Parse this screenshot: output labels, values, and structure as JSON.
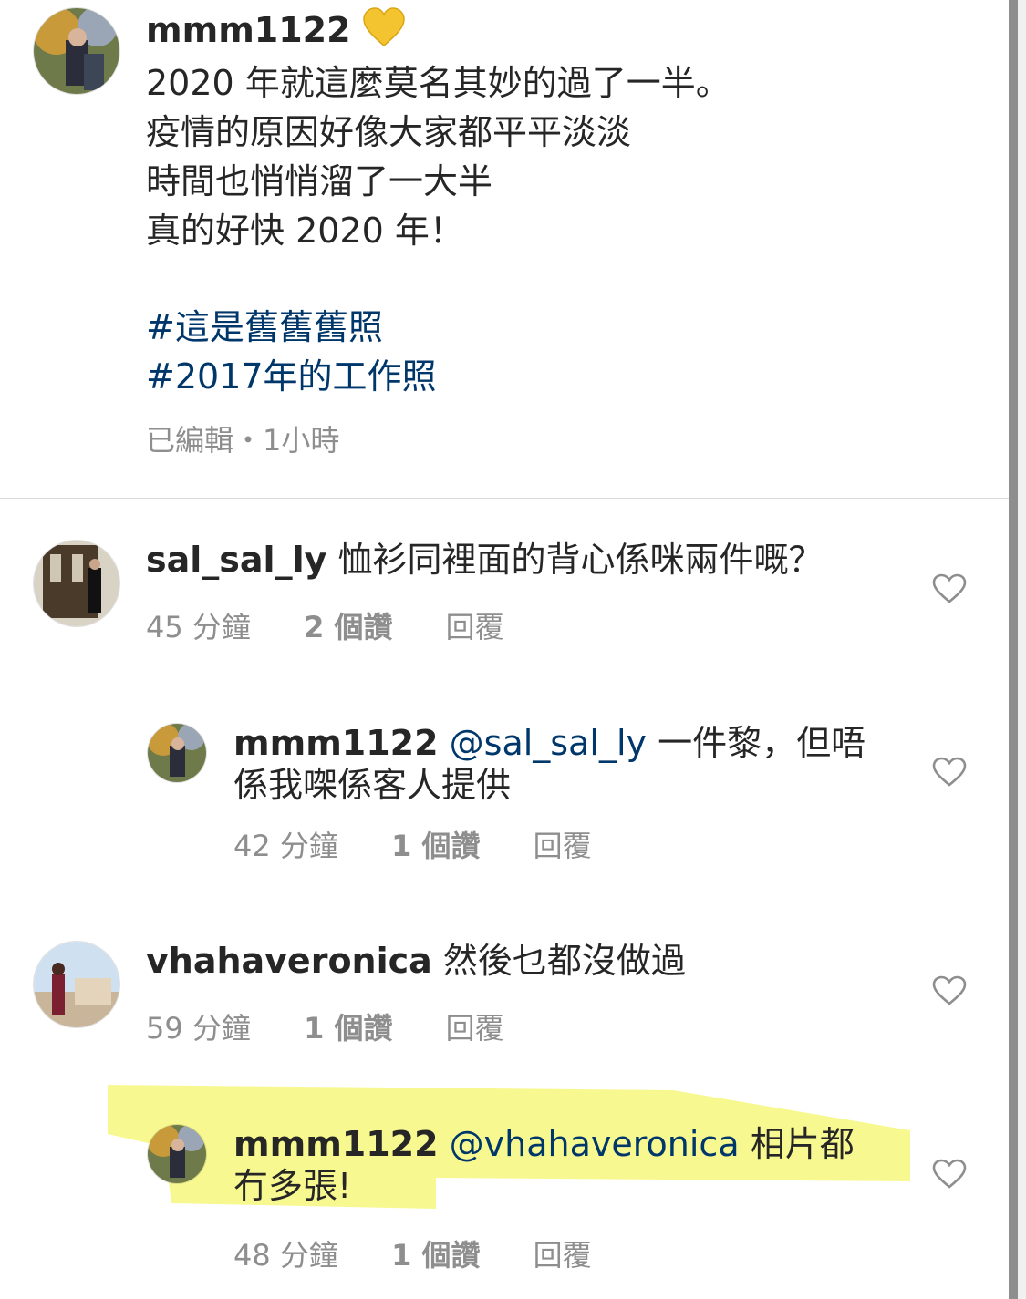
{
  "caption": {
    "username": "mmm1122",
    "emoji": "yellow-heart-emoji",
    "lines": [
      "2020 年就這麼莫名其妙的過了一半。",
      "疫情的原因好像大家都平平淡淡",
      "時間也悄悄溜了一大半",
      "真的好快 2020 年！"
    ],
    "hashtags": [
      "#這是舊舊舊照",
      "#2017年的工作照"
    ],
    "meta": "已編輯・1小時"
  },
  "comments": [
    {
      "username": "sal_sal_ly",
      "text": "恤衫同裡面的背心係咪兩件嘅？",
      "time": "45 分鐘",
      "likes": "2 個讚",
      "reply": "回覆"
    },
    {
      "username": "mmm1122",
      "mention": "@sal_sal_ly",
      "text": "一件黎，但唔係我㗎係客人提供",
      "time": "42 分鐘",
      "likes": "1 個讚",
      "reply": "回覆"
    },
    {
      "username": "vhahaveronica",
      "text": "然後乜都沒做過",
      "time": "59 分鐘",
      "likes": "1 個讚",
      "reply": "回覆"
    },
    {
      "username": "mmm1122",
      "mention": "@vhahaveronica",
      "text": "相片都冇多張!",
      "time": "48 分鐘",
      "likes": "1 個讚",
      "reply": "回覆"
    }
  ],
  "icons": {
    "like": "heart-outline-icon"
  },
  "colors": {
    "text": "#262626",
    "secondary": "#8e8e8e",
    "link": "#00376b",
    "highlight": "#f5f56b",
    "yellow_heart": "#f4c430"
  }
}
